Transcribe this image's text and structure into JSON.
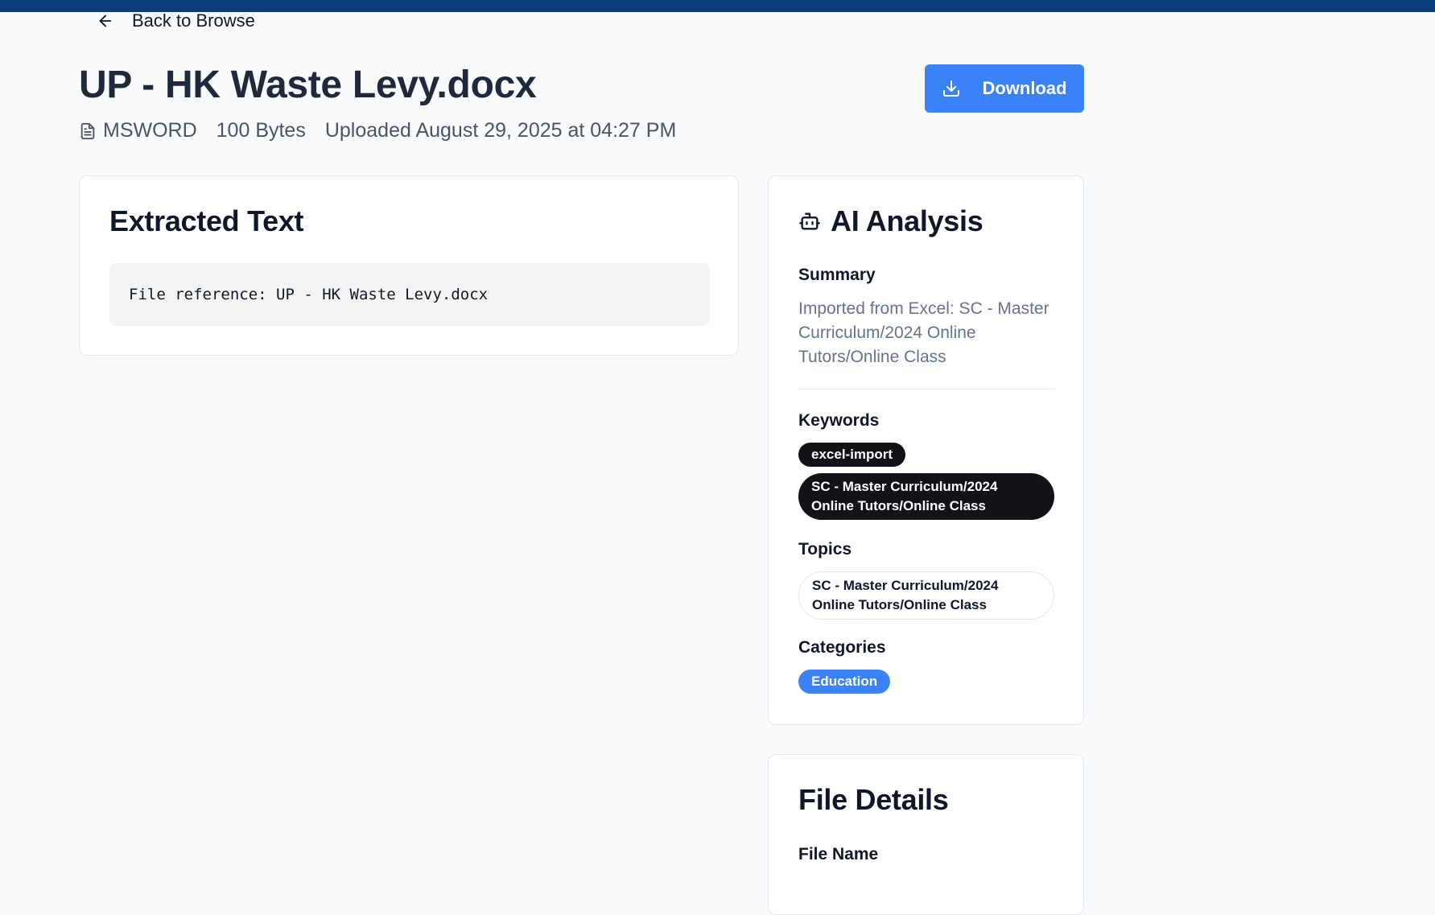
{
  "nav": {
    "back_label": "Back to Browse"
  },
  "file": {
    "title": "UP - HK Waste Levy.docx",
    "type": "MSWORD",
    "size": "100 Bytes",
    "uploaded": "Uploaded August 29, 2025 at 04:27 PM"
  },
  "actions": {
    "download_label": "Download"
  },
  "extracted": {
    "heading": "Extracted Text",
    "content": "File reference: UP - HK Waste Levy.docx"
  },
  "ai": {
    "heading": "AI Analysis",
    "summary_label": "Summary",
    "summary": "Imported from Excel: SC - Master Curriculum/2024 Online Tutors/Online Class",
    "keywords_label": "Keywords",
    "keywords": [
      "excel-import",
      "SC - Master Curriculum/2024 Online Tutors/Online Class"
    ],
    "topics_label": "Topics",
    "topics": [
      "SC - Master Curriculum/2024 Online Tutors/Online Class"
    ],
    "categories_label": "Categories",
    "categories": [
      "Education"
    ]
  },
  "details": {
    "heading": "File Details",
    "file_name_label": "File Name"
  },
  "colors": {
    "topbar": "#0b3d7a",
    "primary": "#3b82f6",
    "pill_dark": "#111318"
  }
}
